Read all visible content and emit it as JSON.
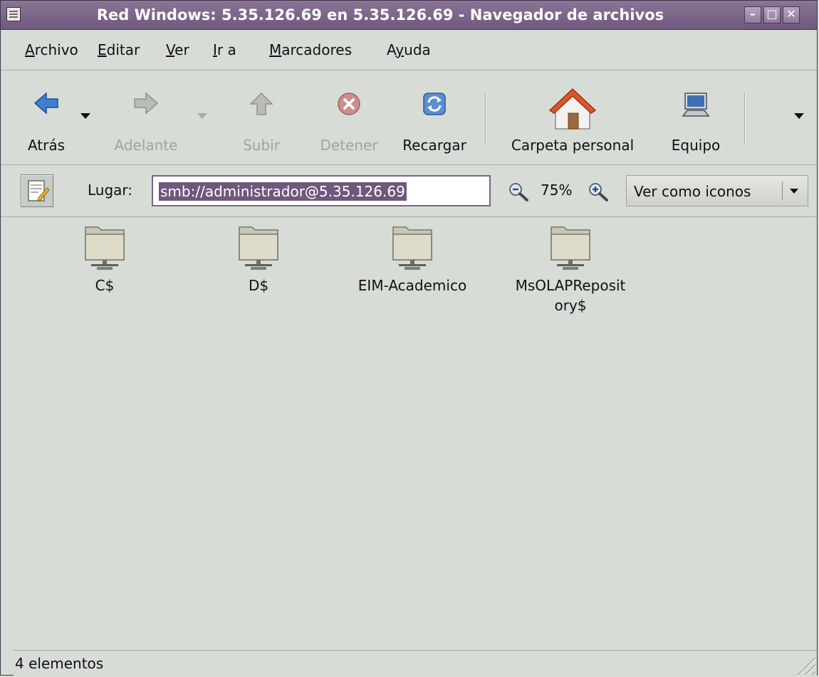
{
  "window": {
    "title": "Red Windows: 5.35.126.69 en 5.35.126.69 - Navegador de archivos",
    "minimize_glyph": "–",
    "maximize_glyph": "□",
    "close_glyph": "✕"
  },
  "menu": [
    {
      "mn": "A",
      "rest": "rchivo"
    },
    {
      "mn": "E",
      "rest": "ditar"
    },
    {
      "mn": "V",
      "rest": "er"
    },
    {
      "mn": "I",
      "rest": "r a"
    },
    {
      "mn": "M",
      "rest": "arcadores"
    },
    {
      "pre": "A",
      "mn": "y",
      "rest": "uda"
    }
  ],
  "toolbar": {
    "back": {
      "label": "Atrás",
      "icon": "arrow-left-icon",
      "enabled": true
    },
    "forward": {
      "label": "Adelante",
      "icon": "arrow-right-icon",
      "enabled": false
    },
    "up": {
      "label": "Subir",
      "icon": "arrow-up-icon",
      "enabled": false
    },
    "stop": {
      "label": "Detener",
      "icon": "stop-icon",
      "enabled": false
    },
    "reload": {
      "label": "Recargar",
      "icon": "reload-icon",
      "enabled": true
    },
    "home": {
      "label": "Carpeta personal",
      "icon": "home-icon",
      "enabled": true
    },
    "computer": {
      "label": "Equipo",
      "icon": "computer-icon",
      "enabled": true
    }
  },
  "location": {
    "label": "Lugar:",
    "value": "smb://administrador@5.35.126.69",
    "zoom": "75%",
    "view_mode": "Ver como iconos"
  },
  "files": [
    {
      "name": "C$",
      "icon": "network-share-folder-icon"
    },
    {
      "name": "D$",
      "icon": "network-share-folder-icon"
    },
    {
      "name": "EIM-Academico",
      "icon": "network-share-folder-icon"
    },
    {
      "name": "MsOLAPReposit\nory$",
      "icon": "network-share-folder-icon"
    }
  ],
  "status": {
    "text": "4 elementos"
  },
  "colors": {
    "titlebar": "#6f587d",
    "selection": "#6f587d",
    "background": "#d8dcd6"
  }
}
